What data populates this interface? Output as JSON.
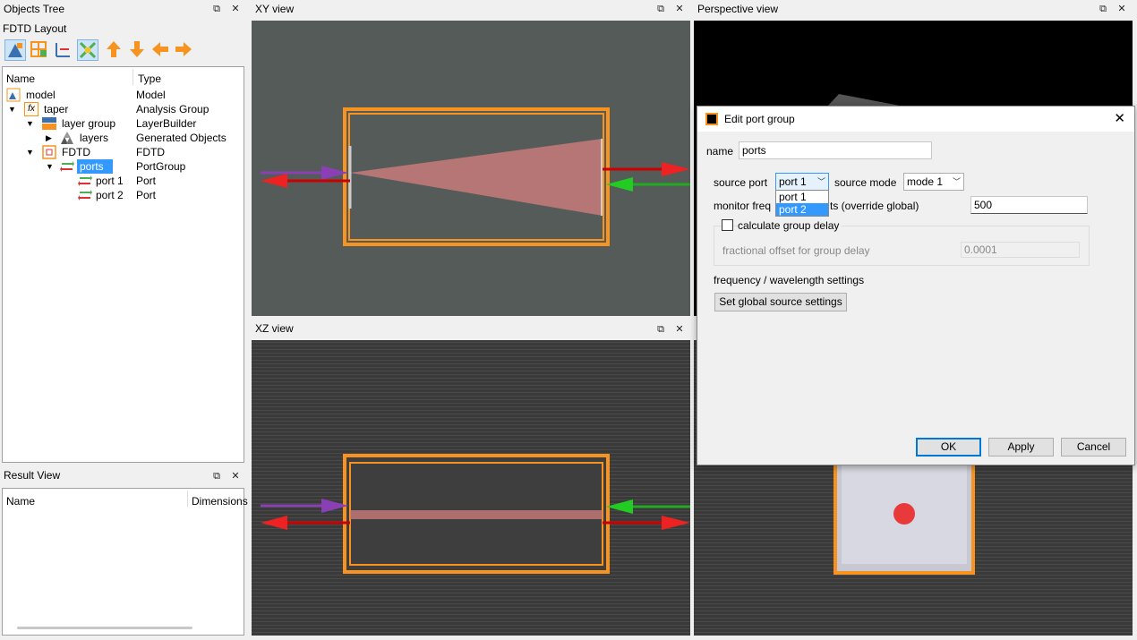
{
  "objects_tree": {
    "title": "Objects Tree",
    "layout_label": "FDTD Layout",
    "columns": [
      "Name",
      "Type"
    ],
    "rows": [
      {
        "name": "model",
        "type": "Model"
      },
      {
        "name": "taper",
        "type": "Analysis Group"
      },
      {
        "name": "layer group",
        "type": "LayerBuilder"
      },
      {
        "name": "layers",
        "type": "Generated Objects"
      },
      {
        "name": "FDTD",
        "type": "FDTD"
      },
      {
        "name": "ports",
        "type": "PortGroup"
      },
      {
        "name": "port 1",
        "type": "Port"
      },
      {
        "name": "port 2",
        "type": "Port"
      }
    ],
    "fx_glyph": "fx"
  },
  "result_view": {
    "title": "Result View",
    "columns": [
      "Name",
      "Dimensions"
    ]
  },
  "views": {
    "xy_title": "XY view",
    "xz_title": "XZ view",
    "perspective_title": "Perspective view"
  },
  "dialog": {
    "title": "Edit port group",
    "name_label": "name",
    "name_value": "ports",
    "source_port_label": "source port",
    "source_port_value": "port 1",
    "source_port_options": [
      "port 1",
      "port 2"
    ],
    "source_mode_label": "source mode",
    "source_mode_value": "mode 1",
    "monitor_prefix": "monitor freq",
    "monitor_suffix": "ts (override global)",
    "monitor_value": "500",
    "calc_group_delay_label": "calculate group delay",
    "fractional_offset_label": "fractional offset for group delay",
    "fractional_offset_value": "0.0001",
    "freq_wavelength_label": "frequency / wavelength settings",
    "set_global_button": "Set global source settings",
    "ok_button": "OK",
    "apply_button": "Apply",
    "cancel_button": "Cancel"
  },
  "colors": {
    "orange": "#f7931e",
    "xy_bg": "#545b58",
    "xz_bg": "#3a3a3a",
    "selection": "#3399ff"
  }
}
